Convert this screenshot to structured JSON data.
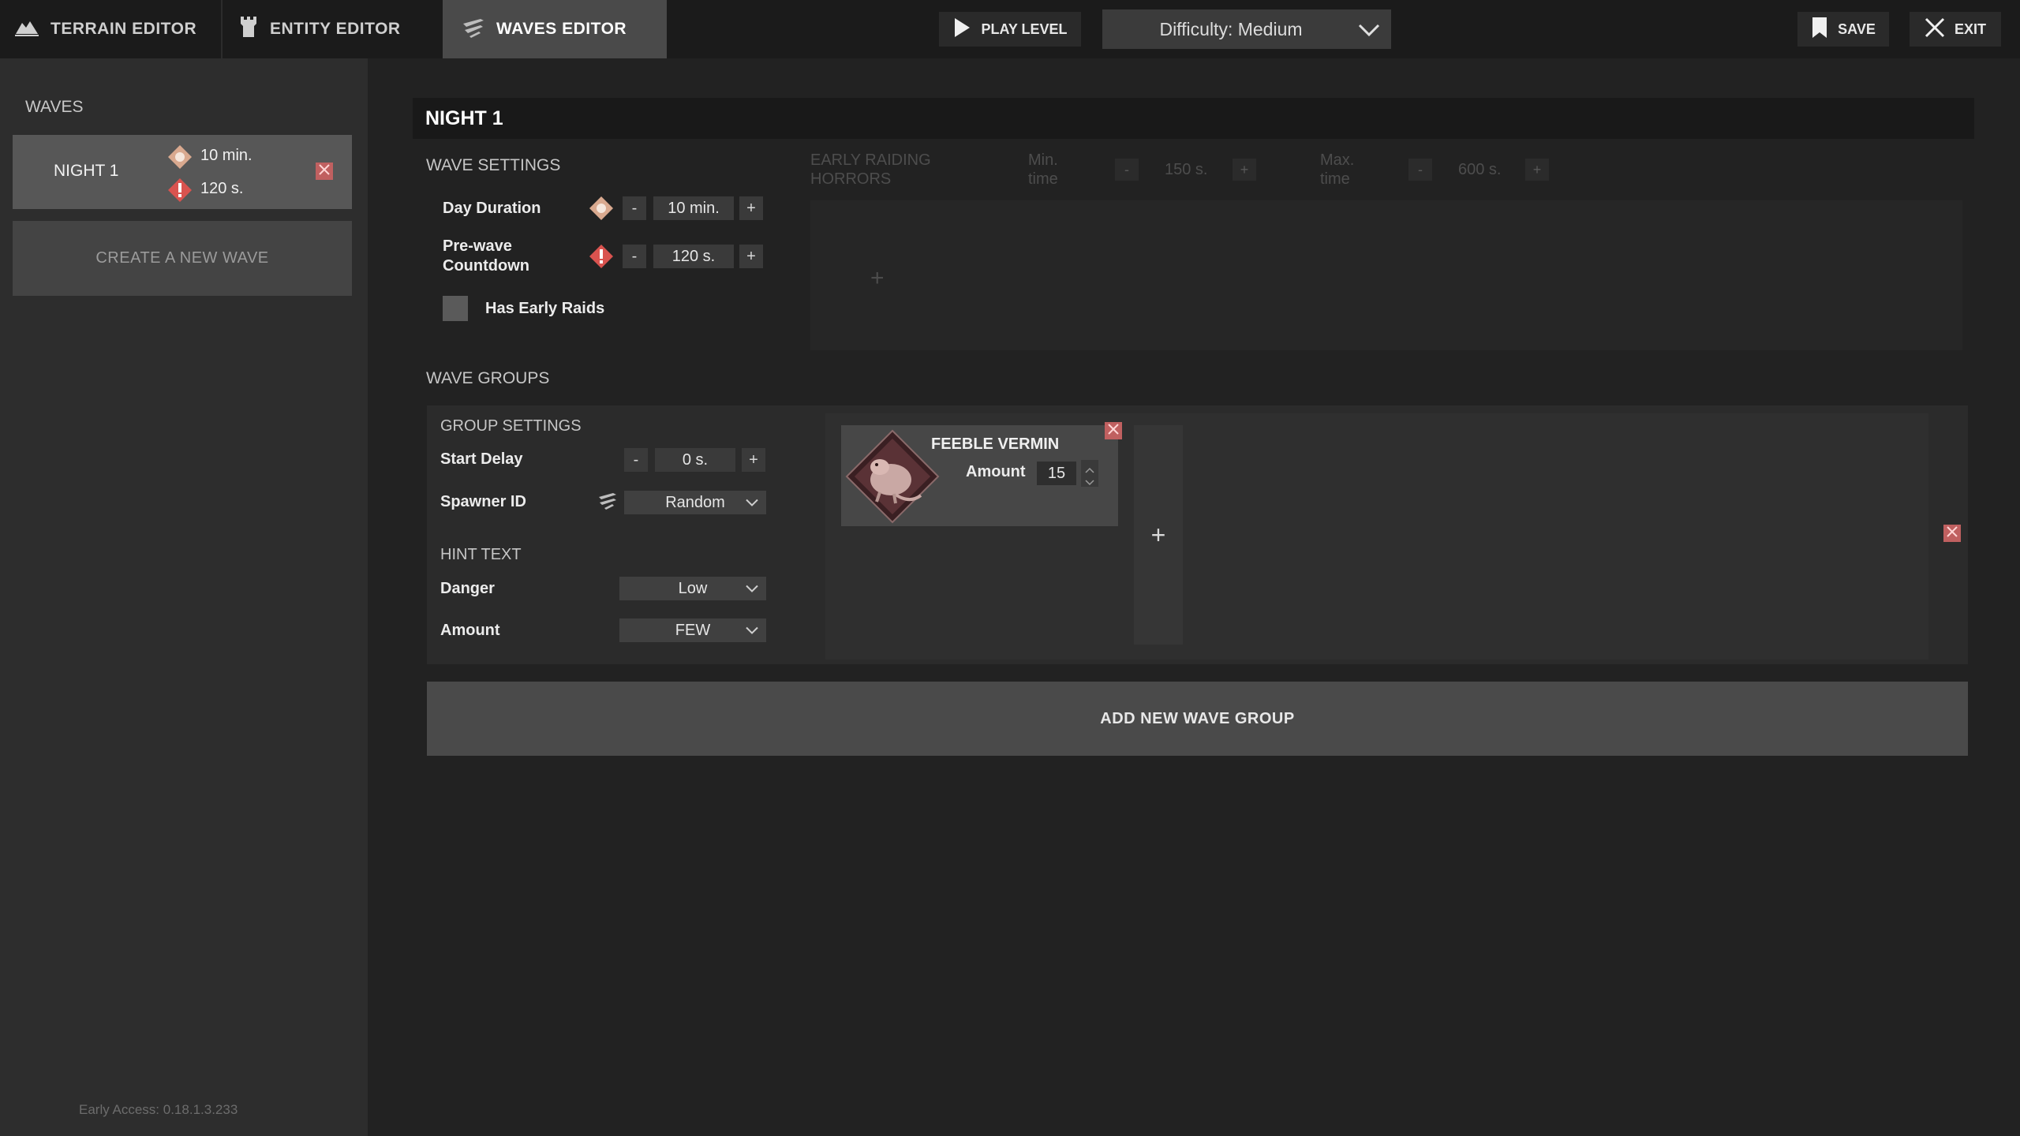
{
  "tabs": {
    "terrain": "TERRAIN EDITOR",
    "entity": "ENTITY EDITOR",
    "waves": "WAVES EDITOR"
  },
  "toolbar": {
    "play_label": "PLAY LEVEL",
    "difficulty": "Difficulty: Medium",
    "save_label": "SAVE",
    "exit_label": "EXIT"
  },
  "sidebar": {
    "title": "WAVES",
    "waves": [
      {
        "name": "NIGHT 1",
        "duration": "10 min.",
        "countdown": "120 s."
      }
    ],
    "create_label": "CREATE A NEW WAVE",
    "version": "Early Access: 0.18.1.3.233"
  },
  "wave": {
    "title": "NIGHT 1",
    "settings_title": "WAVE SETTINGS",
    "day_duration_label": "Day Duration",
    "day_duration_value": "10 min.",
    "prewave_label_1": "Pre-wave",
    "prewave_label_2": "Countdown",
    "prewave_value": "120 s.",
    "early_raids_label": "Has Early Raids",
    "early_raids_checked": false
  },
  "early_raiding": {
    "title_1": "EARLY RAIDING",
    "title_2": "HORRORS",
    "min_label_1": "Min.",
    "min_label_2": "time",
    "min_value": "150 s.",
    "max_label_1": "Max.",
    "max_label_2": "time",
    "max_value": "600 s."
  },
  "groups": {
    "title": "WAVE GROUPS",
    "settings_title": "GROUP SETTINGS",
    "start_delay_label": "Start Delay",
    "start_delay_value": "0 s.",
    "spawner_label": "Spawner ID",
    "spawner_value": "Random",
    "hint_title": "HINT TEXT",
    "danger_label": "Danger",
    "danger_value": "Low",
    "amount_label": "Amount",
    "amount_value": "FEW",
    "enemy": {
      "name": "FEEBLE VERMIN",
      "amount_label": "Amount",
      "amount_value": "15"
    },
    "add_group_label": "ADD NEW WAVE GROUP"
  },
  "symbols": {
    "minus": "-",
    "plus": "+"
  },
  "colors": {
    "active_tab": "#4a4a4a",
    "delete_red": "#c06060",
    "countdown_red": "#d9534f",
    "sun_tan": "#d9a98f"
  }
}
